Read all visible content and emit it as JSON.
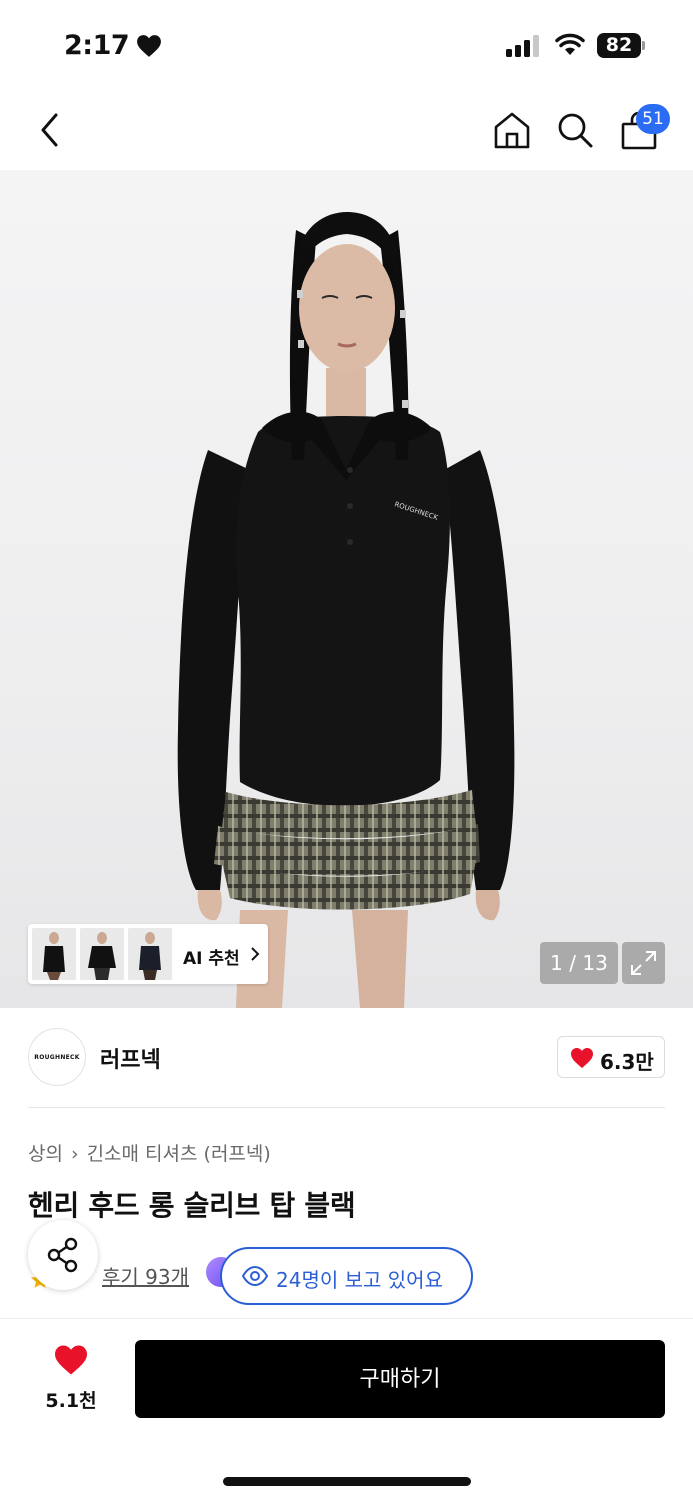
{
  "status_bar": {
    "time": "2:17",
    "battery": "82"
  },
  "cart": {
    "badge_count": "51"
  },
  "gallery": {
    "ai_label": "AI 추천",
    "pager": "1 / 13"
  },
  "brand": {
    "logo_text": "ROUGHNECK",
    "name": "러프넥",
    "likes": "6.3만"
  },
  "breadcrumb": {
    "category": "상의",
    "subcategory": "긴소매 티셔츠 (러프넥)"
  },
  "product": {
    "title": "헨리 후드 롱 슬리브 탑 블랙",
    "reviews": "후기 93개",
    "viewers": "24명이 보고 있어요"
  },
  "footer": {
    "wish_count": "5.1천",
    "buy_label": "구매하기"
  },
  "colors": {
    "accent_blue": "#2c5fd6",
    "badge_blue": "#2a6df4",
    "heart_red": "#e8122a"
  }
}
